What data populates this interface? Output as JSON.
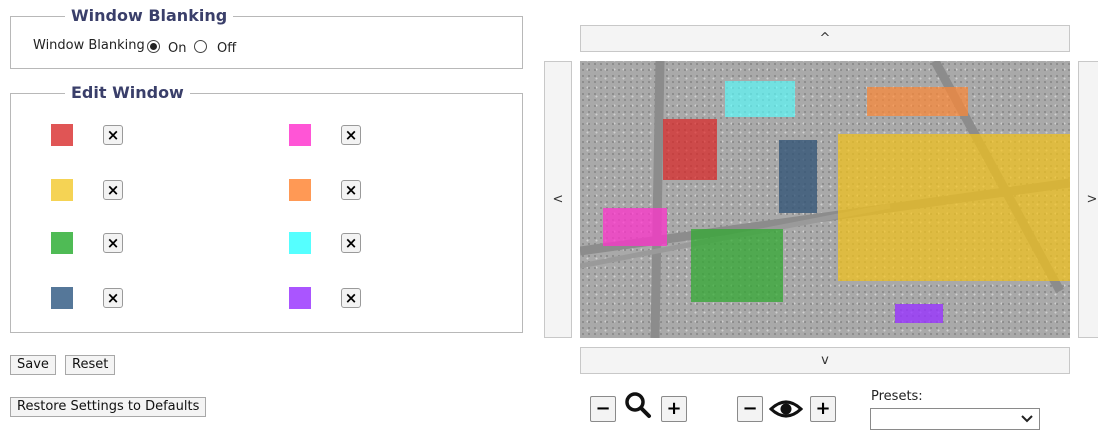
{
  "window_blanking": {
    "legend": "Window Blanking",
    "label": "Window Blanking",
    "on_label": "On",
    "off_label": "Off",
    "selected": "On"
  },
  "edit_window": {
    "legend": "Edit Window",
    "delete_label": "×",
    "windows": [
      {
        "color": "#e05555"
      },
      {
        "color": "#ff55d6"
      },
      {
        "color": "#f5d354"
      },
      {
        "color": "#ff9955"
      },
      {
        "color": "#4fbb55"
      },
      {
        "color": "#55ffff"
      },
      {
        "color": "#557799"
      },
      {
        "color": "#aa55ff"
      }
    ]
  },
  "buttons": {
    "save": "Save",
    "reset": "Reset",
    "restore": "Restore Settings to Defaults"
  },
  "navigation": {
    "up": "^",
    "down": "v",
    "left": "<",
    "right": ">"
  },
  "zoom": {
    "minus": "−",
    "plus": "+",
    "icon": "search-icon"
  },
  "focus": {
    "minus": "−",
    "plus": "+",
    "icon": "eye-icon"
  },
  "presets": {
    "label": "Presets:",
    "selected": ""
  }
}
